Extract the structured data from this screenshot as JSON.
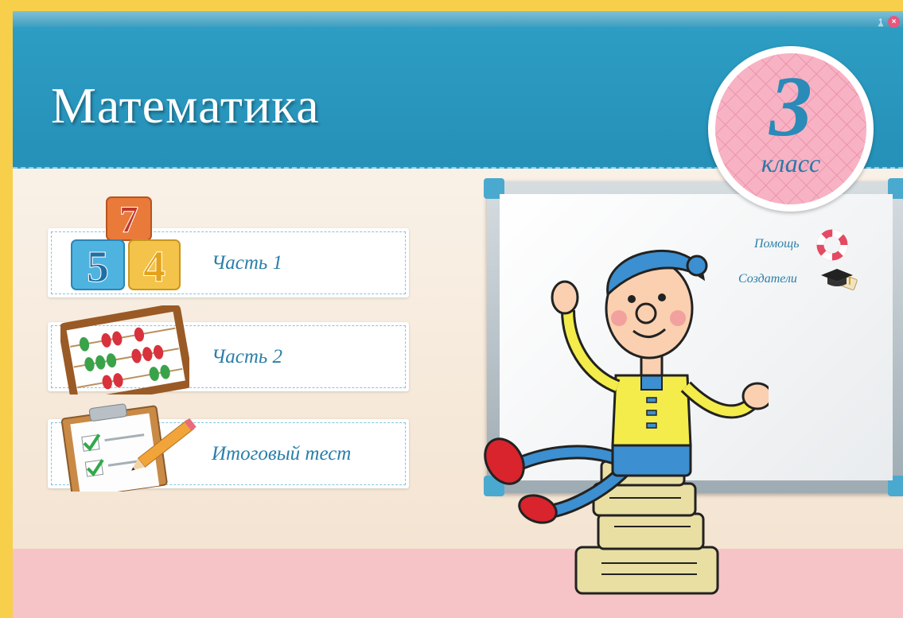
{
  "window": {
    "minimize_label": "1",
    "close_label": "×"
  },
  "header": {
    "title": "Математика"
  },
  "grade_badge": {
    "number": "3",
    "word": "класс"
  },
  "menu": {
    "items": [
      {
        "label": "Часть 1",
        "icon": "number-blocks-icon"
      },
      {
        "label": "Часть 2",
        "icon": "abacus-icon"
      },
      {
        "label": "Итоговый тест",
        "icon": "clipboard-test-icon"
      }
    ]
  },
  "board_links": {
    "help": {
      "label": "Помощь",
      "icon": "lifebuoy-icon"
    },
    "creators": {
      "label": "Создатели",
      "icon": "graduation-cap-icon"
    }
  },
  "colors": {
    "header": "#2590b8",
    "frame": "#f8cf4a",
    "footer": "#f6c3c7",
    "link": "#2a7fa9",
    "badge": "#f7b2c4"
  }
}
